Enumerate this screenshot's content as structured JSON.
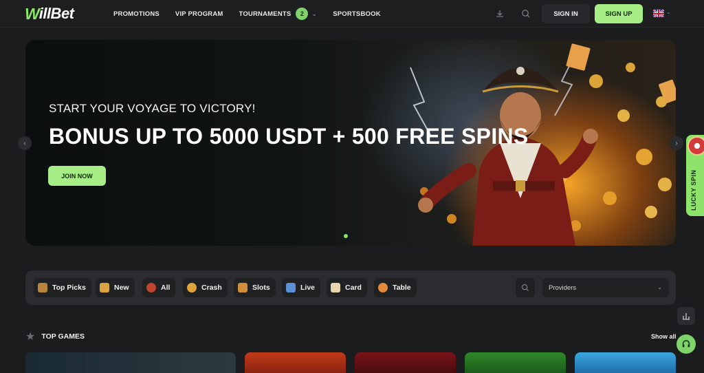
{
  "brand": {
    "logo_w": "W",
    "logo_rest": "illBet"
  },
  "nav": {
    "promotions": "PROMOTIONS",
    "vip": "VIP PROGRAM",
    "tournaments": "TOURNAMENTS",
    "tournaments_badge": "2",
    "sportsbook": "SPORTSBOOK"
  },
  "auth": {
    "sign_in": "SIGN IN",
    "sign_up": "SIGN UP"
  },
  "hero": {
    "subtitle": "START YOUR VOYAGE TO VICTORY!",
    "title": "BONUS UP TO 5000 USDT + 500 FREE SPINS",
    "cta": "JOIN NOW"
  },
  "lucky_spin": "LUCKY SPIN",
  "categories": [
    {
      "label": "Top Picks",
      "icon": "treasure-chest-icon",
      "color": "#b8843c"
    },
    {
      "label": "New",
      "icon": "new-icon",
      "color": "#d9a440"
    },
    {
      "label": "All",
      "icon": "roulette-icon",
      "color": "#c0452e"
    },
    {
      "label": "Crash",
      "icon": "crash-icon",
      "color": "#e0a23a"
    },
    {
      "label": "Slots",
      "icon": "slots-icon",
      "color": "#d0903a"
    },
    {
      "label": "Live",
      "icon": "live-icon",
      "color": "#5b8fd6"
    },
    {
      "label": "Card",
      "icon": "card-icon",
      "color": "#e8d6b0"
    },
    {
      "label": "Table",
      "icon": "table-icon",
      "color": "#e08a3a"
    }
  ],
  "providers_placeholder": "Providers",
  "section": {
    "title": "TOP GAMES",
    "show_all": "Show all"
  },
  "colors": {
    "accent": "#a8ee86",
    "badge": "#7fd36a",
    "background": "#1b1c1e"
  }
}
